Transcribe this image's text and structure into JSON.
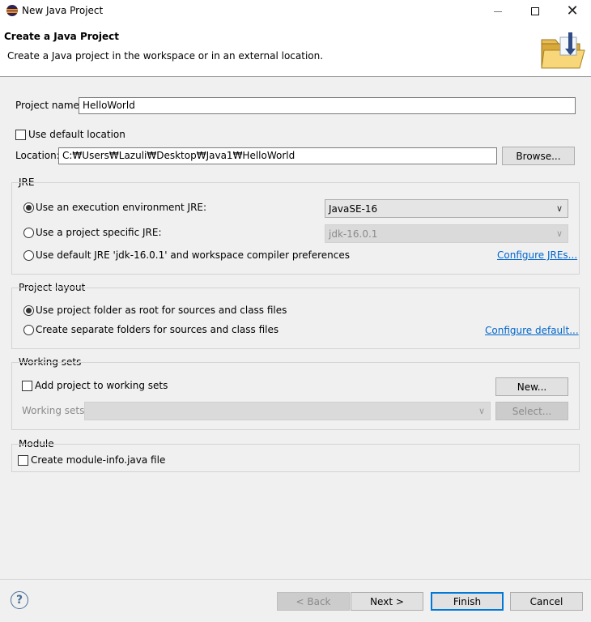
{
  "window": {
    "title": "New Java Project",
    "close_glyph": "✕"
  },
  "banner": {
    "title": "Create a Java Project",
    "description": "Create a Java project in the workspace or in an external location."
  },
  "project": {
    "name_label": "Project name:",
    "name_value": "HelloWorld",
    "use_default_location_label": "Use default location",
    "use_default_location_checked": false,
    "location_label": "Location:",
    "location_value": "C:₩Users₩Lazuli₩Desktop₩Java1₩HelloWorld",
    "browse_label": "Browse..."
  },
  "jre": {
    "group_label": "JRE",
    "option_env_label": "Use an execution environment JRE:",
    "option_env_value": "JavaSE-16",
    "option_specific_label": "Use a project specific JRE:",
    "option_specific_value": "jdk-16.0.1",
    "option_default_label": "Use default JRE 'jdk-16.0.1' and workspace compiler preferences",
    "configure_link": "Configure JREs...",
    "selected": "env"
  },
  "layout": {
    "group_label": "Project layout",
    "option_root_label": "Use project folder as root for sources and class files",
    "option_separate_label": "Create separate folders for sources and class files",
    "configure_link": "Configure default...",
    "selected": "root"
  },
  "working_sets": {
    "group_label": "Working sets",
    "add_label": "Add project to working sets",
    "add_checked": false,
    "new_label": "New...",
    "sets_label": "Working sets:",
    "sets_value": "",
    "select_label": "Select..."
  },
  "module": {
    "group_label": "Module",
    "create_label": "Create module-info.java file",
    "create_checked": false
  },
  "footer": {
    "help_glyph": "?",
    "back_label": "< Back",
    "next_label": "Next >",
    "finish_label": "Finish",
    "cancel_label": "Cancel"
  },
  "colors": {
    "accent": "#0078d7",
    "link": "#0066cc",
    "dialog_bg": "#f0f0f0"
  }
}
